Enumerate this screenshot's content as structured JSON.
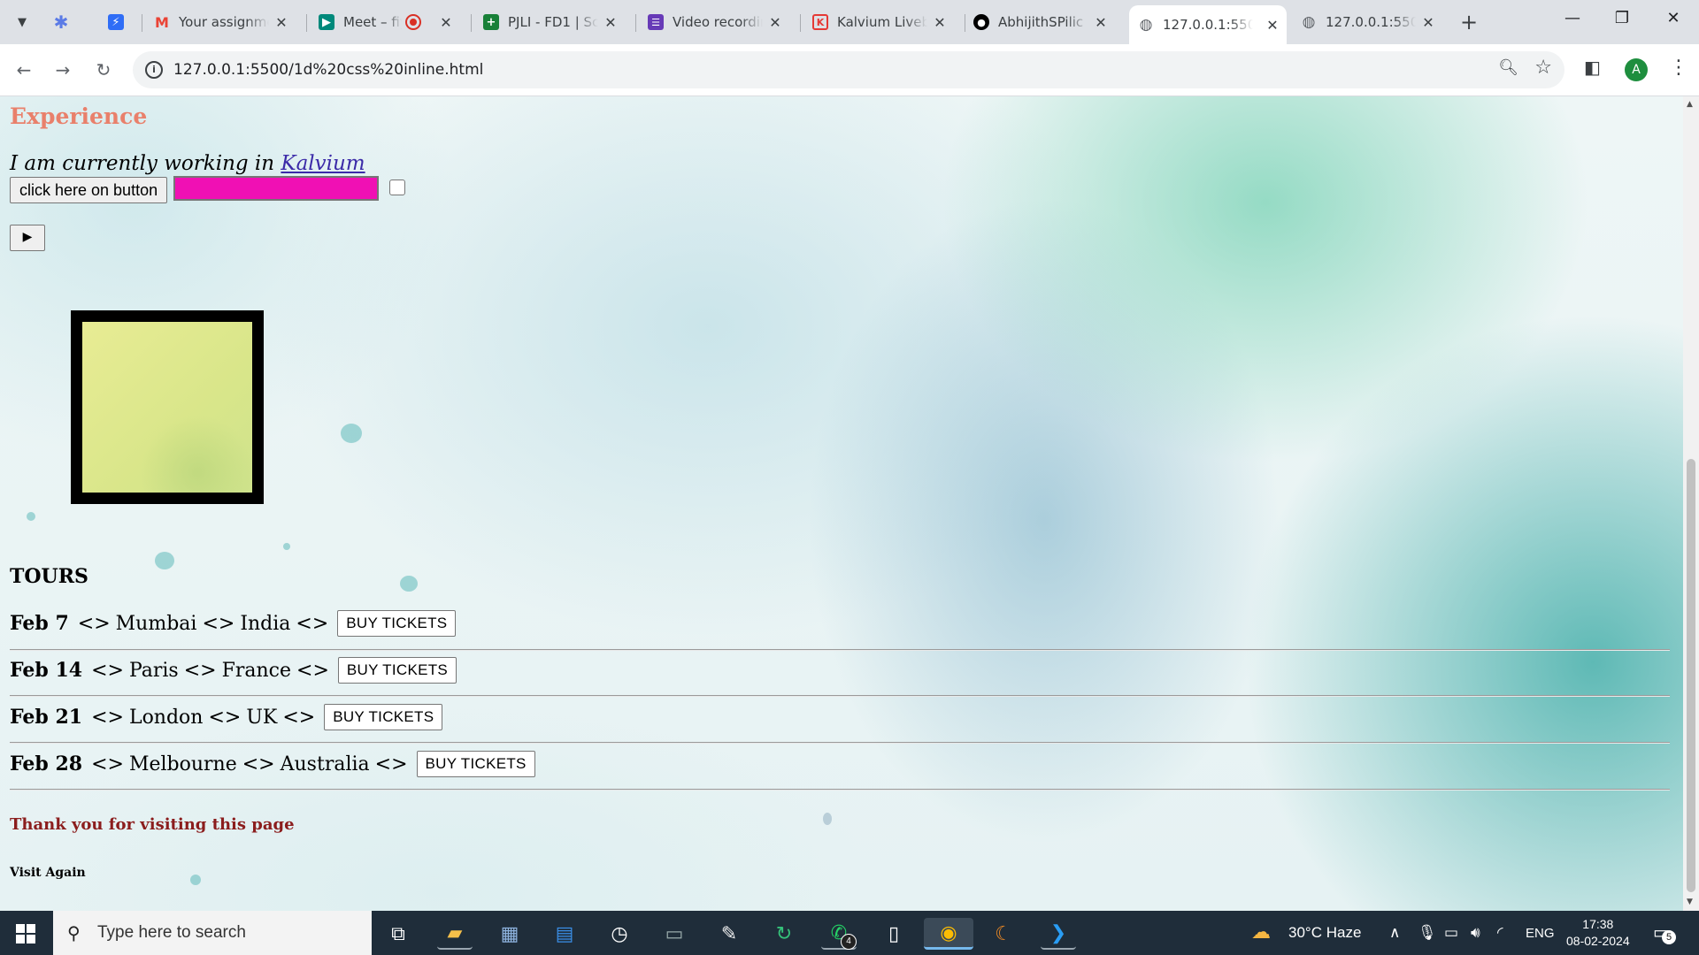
{
  "browser": {
    "tabs": [
      {
        "title": "Your assignme",
        "favicon": "gmail-icon",
        "color": "#ea4335"
      },
      {
        "title": "Meet – fiy",
        "favicon": "meet-icon",
        "color": "#00897b",
        "recording": true
      },
      {
        "title": "PJLI - FD1 | Sc",
        "favicon": "sheets-icon",
        "color": "#188038"
      },
      {
        "title": "Video recordin",
        "favicon": "forms-icon",
        "color": "#673ab7"
      },
      {
        "title": "Kalvium Liveb",
        "favicon": "kalvium-icon",
        "color": "#e53935"
      },
      {
        "title": "AbhijithSPilic",
        "favicon": "github-icon",
        "color": "#000000"
      },
      {
        "title": "127.0.0.1:5500",
        "favicon": "globe-icon",
        "color": "#5f6368",
        "active": true
      },
      {
        "title": "127.0.0.1:5500",
        "favicon": "globe-icon",
        "color": "#5f6368"
      }
    ],
    "url": "127.0.0.1:5500/1d%20css%20inline.html",
    "profile_initial": "A"
  },
  "page": {
    "experience_heading": "Experience",
    "working_text": "I am currently working in ",
    "working_link": "Kalvium",
    "click_button": "click here on button",
    "color_value": "#f010b4",
    "play_symbol": "▶",
    "tours_heading": "TOURS",
    "separator": "<>",
    "buy_label": "BUY TICKETS",
    "tours": [
      {
        "date": "Feb 7",
        "city": "Mumbai",
        "country": "India"
      },
      {
        "date": "Feb 14",
        "city": "Paris",
        "country": "France"
      },
      {
        "date": "Feb 21",
        "city": "London",
        "country": "UK"
      },
      {
        "date": "Feb 28",
        "city": "Melbourne",
        "country": "Australia"
      }
    ],
    "thanks": "Thank you for visiting this page",
    "visit_again": "Visit Again"
  },
  "taskbar": {
    "search_placeholder": "Type here to search",
    "whatsapp_badge": "4",
    "weather": "30°C  Haze",
    "language": "ENG",
    "time": "17:38",
    "date": "08-02-2024",
    "notifications": "5"
  }
}
